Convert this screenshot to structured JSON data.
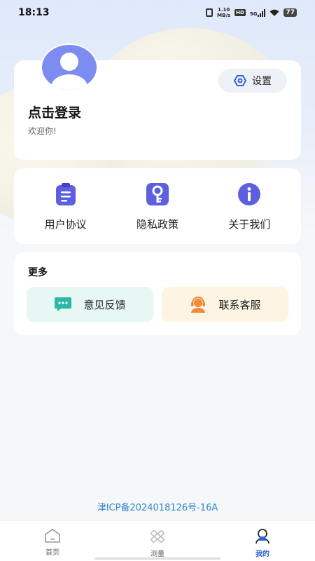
{
  "status_bar": {
    "time": "18:13",
    "speed_value": "1.10",
    "speed_unit": "MB/s",
    "hd_tag": "HD",
    "network_tag": "5G",
    "battery": "77"
  },
  "profile": {
    "login_label": "点击登录",
    "welcome": "欢迎你!",
    "settings_label": "设置"
  },
  "menu": {
    "items": [
      {
        "label": "用户协议",
        "icon": "document-icon"
      },
      {
        "label": "隐私政策",
        "icon": "key-icon"
      },
      {
        "label": "关于我们",
        "icon": "info-icon"
      }
    ]
  },
  "more": {
    "title": "更多",
    "feedback_label": "意见反馈",
    "service_label": "联系客服"
  },
  "footer": {
    "icp": "津ICP备2024018126号-16A"
  },
  "tabs": [
    {
      "label": "首页",
      "icon": "home-icon"
    },
    {
      "label": "测量",
      "icon": "ruler-icon"
    },
    {
      "label": "我的",
      "icon": "profile-icon",
      "active": true
    }
  ],
  "colors": {
    "accent": "#2b63d8",
    "icon_purple": "#5b5fe0",
    "feedback_bg": "#e7f7f3",
    "service_bg": "#fdf4e4"
  }
}
